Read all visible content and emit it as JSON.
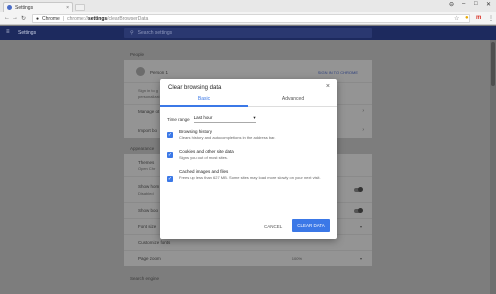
{
  "browser": {
    "tab_title": "Settings",
    "tab_close": "×",
    "window_controls": [
      "⊖",
      "–",
      "□",
      "✕"
    ],
    "omnibox": {
      "chrome_label": "Chrome",
      "separator": "|",
      "url_scheme": "chrome://",
      "url_host": "settings",
      "url_path": "/clearBrowserData"
    },
    "icons": [
      "back-icon",
      "forward-icon",
      "reload-icon",
      "secure-icon",
      "star-icon",
      "extension-icon",
      "gmail-icon",
      "menu-icon"
    ],
    "extension_color": "#e8a800",
    "gmail_color": "#d93025"
  },
  "header": {
    "menu_icon": "≡",
    "title": "Settings",
    "search_placeholder": "Search settings"
  },
  "background": {
    "people_heading": "People",
    "person_name": "Person 1",
    "sign_out_label": "SIGN IN TO CHROME",
    "sign_in_line1": "Sign in to g",
    "sign_in_line2": "personalizat",
    "manage_label": "Manage ot",
    "import_label": "Import bo",
    "appearance_heading": "Appearance",
    "themes_label": "Themes",
    "themes_sub": "Open Chr",
    "show_home_label": "Show hom",
    "show_home_sub": "Disabled",
    "show_bookmarks_label": "Show boo",
    "font_size_label": "Font size",
    "customize_fonts_label": "Customize fonts",
    "page_zoom_label": "Page zoom",
    "page_zoom_value": "100%",
    "search_engine_heading": "Search engine"
  },
  "dialog": {
    "title": "Clear browsing data",
    "close_icon": "×",
    "tabs": [
      "Basic",
      "Advanced"
    ],
    "active_tab": "Basic",
    "time_range_label": "Time range",
    "time_range_value": "Last hour",
    "options": [
      {
        "title": "Browsing history",
        "subtitle": "Clears history and autocompletions in the address bar.",
        "checked": true
      },
      {
        "title": "Cookies and other site data",
        "subtitle": "Signs you out of most sites.",
        "checked": true
      },
      {
        "title": "Cached images and files",
        "subtitle": "Frees up less than 627 MB. Some sites may load more slowly on your next visit.",
        "checked": true
      }
    ],
    "cancel_label": "CANCEL",
    "clear_label": "CLEAR DATA",
    "accent_color": "#3b78e7"
  }
}
